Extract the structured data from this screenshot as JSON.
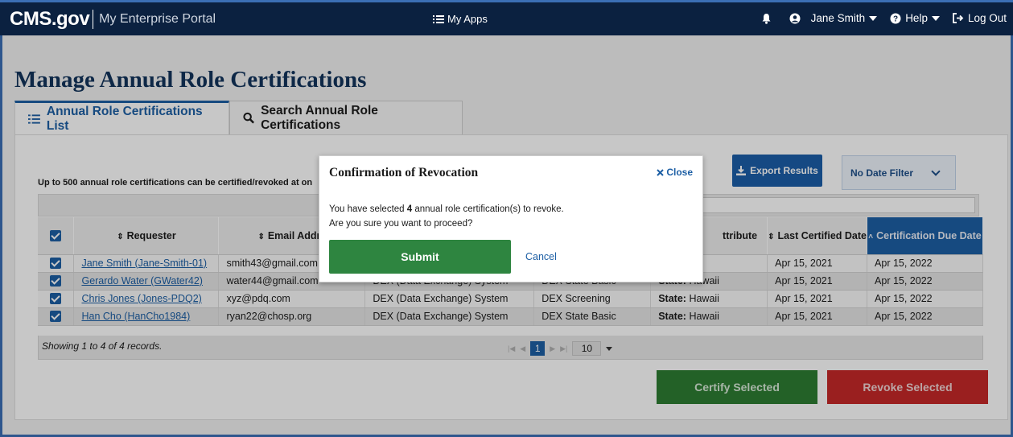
{
  "header": {
    "logo": "CMS.gov",
    "portal": "My Enterprise Portal",
    "my_apps": "My Apps",
    "user": "Jane Smith",
    "help": "Help",
    "logout": "Log Out"
  },
  "page": {
    "title": "Manage Annual Role Certifications",
    "tabs": [
      {
        "label": "Annual Role Certifications List",
        "active": true
      },
      {
        "label": "Search Annual Role Certifications",
        "active": false
      }
    ],
    "info_text": "Up to 500 annual role certifications can be certified/revoked at on",
    "export_label": "Export Results",
    "date_filter": "No Date Filter"
  },
  "table": {
    "headers": {
      "requester": "Requester",
      "email": "Email Addre",
      "attribute": "ttribute",
      "last_certified": "Last Certified Date",
      "due": "Certification Due Date"
    },
    "rows": [
      {
        "requester": "Jane Smith (Jane-Smith-01)",
        "email": "smith43@gmail.com",
        "app": "",
        "role": "",
        "attr_label": "",
        "attr_value": "aii",
        "last": "Apr 15, 2021",
        "due": "Apr 15, 2022"
      },
      {
        "requester": "Gerardo Water (GWater42)",
        "email": "water44@gmail.com",
        "app": "DEX (Data Exchange) System",
        "role": "DEX State Basic",
        "attr_label": "State:",
        "attr_value": "Hawaii",
        "last": "Apr 15, 2021",
        "due": "Apr 15, 2022"
      },
      {
        "requester": "Chris Jones (Jones-PDQ2)",
        "email": "xyz@pdq.com",
        "app": "DEX (Data Exchange) System",
        "role": "DEX Screening",
        "attr_label": "State:",
        "attr_value": "Hawaii",
        "last": "Apr 15, 2021",
        "due": "Apr 15, 2022"
      },
      {
        "requester": "Han Cho (HanCho1984)",
        "email": "ryan22@chosp.org",
        "app": "DEX (Data Exchange) System",
        "role": "DEX State Basic",
        "attr_label": "State:",
        "attr_value": "Hawaii",
        "last": "Apr 15, 2021",
        "due": "Apr 15, 2022"
      }
    ],
    "showing": "Showing 1 to 4 of 4 records.",
    "page": "1",
    "page_size": "10"
  },
  "actions": {
    "certify": "Certify Selected",
    "revoke": "Revoke Selected"
  },
  "modal": {
    "title": "Confirmation of Revocation",
    "close": "Close",
    "line1_pre": "You have selected ",
    "count": "4",
    "line1_post": " annual role certification(s) to revoke.",
    "line2": "Are you sure you want to proceed?",
    "submit": "Submit",
    "cancel": "Cancel"
  },
  "colors": {
    "nav": "#0b2140",
    "primary": "#1d5fa5",
    "certify": "#2e7d32",
    "revoke": "#c62828",
    "submit": "#2e8540"
  }
}
